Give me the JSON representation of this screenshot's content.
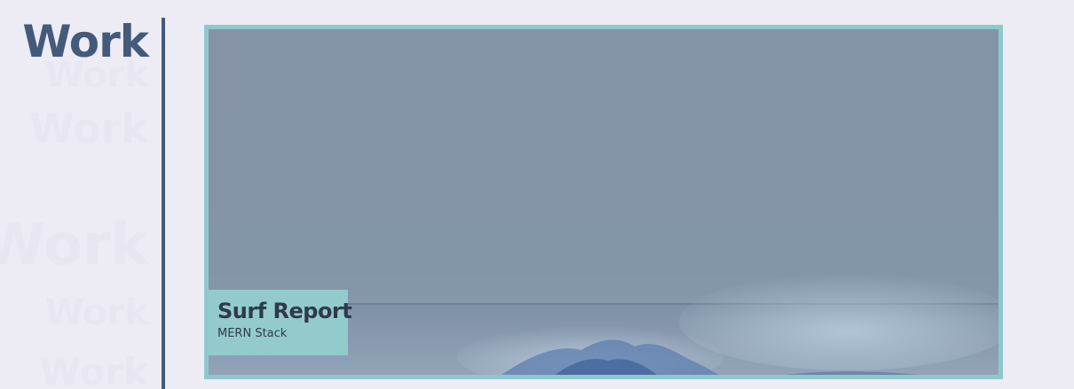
{
  "section": {
    "title": "Work",
    "ghost_words": [
      "Work",
      "Work",
      "Work",
      "Work",
      "Work"
    ]
  },
  "projects": [
    {
      "title": "Surf Report",
      "subtitle": "MERN Stack",
      "image": "ocean-wave-photo"
    }
  ],
  "colors": {
    "background": "#edecf5",
    "heading": "#445a7a",
    "accent": "#8fc8cb",
    "label_text": "#2f3a4c"
  }
}
